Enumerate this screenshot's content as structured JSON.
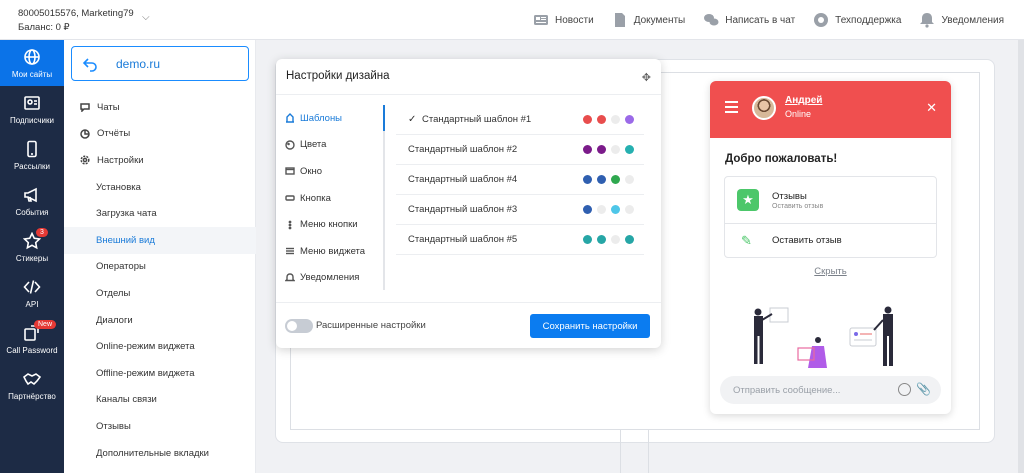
{
  "account": {
    "line1": "80005015576, Marketing79",
    "line2": "Баланс: 0 ₽"
  },
  "topnav": [
    {
      "label": "Новости",
      "icon": "news-icon"
    },
    {
      "label": "Документы",
      "icon": "document-icon"
    },
    {
      "label": "Написать в чат",
      "icon": "chat-icon"
    },
    {
      "label": "Техподдержка",
      "icon": "support-icon"
    },
    {
      "label": "Уведомления",
      "icon": "bell-icon"
    }
  ],
  "leftnav": [
    {
      "label": "Мои сайты",
      "icon": "globe-icon",
      "active": true
    },
    {
      "label": "Подписчики",
      "icon": "contacts-icon"
    },
    {
      "label": "Рассылки",
      "icon": "phone-icon"
    },
    {
      "label": "События",
      "icon": "megaphone-icon"
    },
    {
      "label": "Стикеры",
      "icon": "star-icon",
      "badge": "3"
    },
    {
      "label": "API",
      "icon": "code-icon"
    },
    {
      "label": "Call Password",
      "icon": "call-icon",
      "badge": "New"
    },
    {
      "label": "Партнёрство",
      "icon": "handshake-icon"
    }
  ],
  "sidebar": {
    "domain": "demo.ru",
    "items": [
      {
        "label": "Чаты",
        "icon": "chat-icon"
      },
      {
        "label": "Отчёты",
        "icon": "pie-icon"
      },
      {
        "label": "Настройки",
        "icon": "gear-icon"
      },
      {
        "label": "Установка",
        "sub": true
      },
      {
        "label": "Загрузка чата",
        "sub": true
      },
      {
        "label": "Внешний вид",
        "sub": true,
        "active": true
      },
      {
        "label": "Операторы",
        "sub": true
      },
      {
        "label": "Отделы",
        "sub": true
      },
      {
        "label": "Диалоги",
        "sub": true
      },
      {
        "label": "Online-режим виджета",
        "sub": true
      },
      {
        "label": "Offline-режим виджета",
        "sub": true
      },
      {
        "label": "Каналы связи",
        "sub": true
      },
      {
        "label": "Отзывы",
        "sub": true
      },
      {
        "label": "Дополнительные вкладки",
        "sub": true
      }
    ]
  },
  "panel": {
    "title": "Настройки дизайна",
    "tabs": [
      {
        "label": "Шаблоны",
        "active": true
      },
      {
        "label": "Цвета"
      },
      {
        "label": "Окно"
      },
      {
        "label": "Кнопка"
      },
      {
        "label": "Меню кнопки"
      },
      {
        "label": "Меню виджета"
      },
      {
        "label": "Уведомления"
      }
    ],
    "templates": [
      {
        "label": "Стандартный шаблон #1",
        "checked": true,
        "colors": [
          "#e84d4d",
          "#e84d4d",
          "#ececec",
          "#9b6ae8"
        ]
      },
      {
        "label": "Стандартный шаблон #2",
        "colors": [
          "#7b1b8a",
          "#7b1b8a",
          "#ececec",
          "#26b0b0"
        ]
      },
      {
        "label": "Стандартный шаблон #4",
        "colors": [
          "#2f5fb0",
          "#2f5fb0",
          "#2fa84f",
          "#ececec"
        ]
      },
      {
        "label": "Стандартный шаблон #3",
        "colors": [
          "#2f5fb0",
          "#ececec",
          "#4ec6e8",
          "#ececec"
        ]
      },
      {
        "label": "Стандартный шаблон #5",
        "colors": [
          "#26a6a6",
          "#26a6a6",
          "#ececec",
          "#26a6a6"
        ]
      }
    ],
    "advanced_label": "Расширенные настройки",
    "save_label": "Сохранить настройки"
  },
  "widget": {
    "operator_name": "Андрей",
    "operator_status": "Online",
    "welcome": "Добро пожаловать!",
    "reviews_title": "Отзывы",
    "reviews_sub": "Оставить отзыв",
    "leave_review": "Оставить отзыв",
    "hide": "Скрыть",
    "input_placeholder": "Отправить сообщение...",
    "header_color": "#f04f4f"
  }
}
